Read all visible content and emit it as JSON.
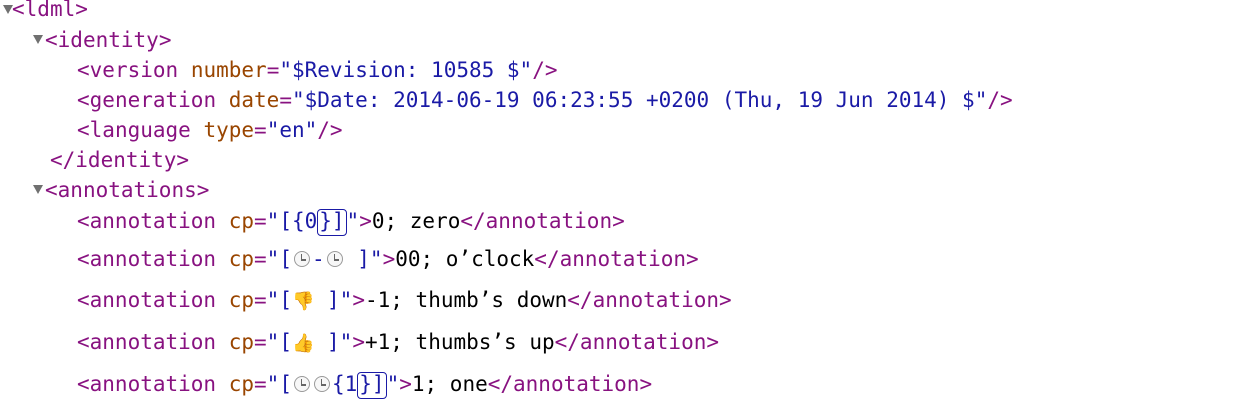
{
  "lines": {
    "ldml_open": {
      "open": "<",
      "name": "ldml",
      "close": ">"
    },
    "identity_open": {
      "open": "<",
      "name": "identity",
      "close": ">"
    },
    "version": {
      "open": "<",
      "name": "version",
      "attr": " number",
      "eq": "=",
      "value": "\"$Revision: 10585 $\"",
      "close": "/>"
    },
    "generation": {
      "open": "<",
      "name": "generation",
      "attr": " date",
      "eq": "=",
      "value": "\"$Date: 2014-06-19 06:23:55 +0200 (Thu, 19 Jun 2014) $\"",
      "close": "/>"
    },
    "language": {
      "open": "<",
      "name": "language",
      "attr": " type",
      "eq": "=",
      "value": "\"en\"",
      "close": "/>"
    },
    "identity_close": {
      "text": "</identity>"
    },
    "annotations_open": {
      "open": "<",
      "name": "annotations",
      "close": ">"
    }
  },
  "annotations": [
    {
      "tag_open": "<annotation",
      "attr": " cp",
      "eq": "=",
      "value_start": "\"[{0",
      "highlight": "}]",
      "value_end": "\"",
      "gt": ">",
      "text": "0; zero",
      "tag_close": "</annotation>"
    },
    {
      "tag_open": "<annotation",
      "attr": " cp",
      "eq": "=",
      "value_start": "\"[",
      "icons": [
        "clock-icon",
        "clock-icon"
      ],
      "separator": "-",
      "value_end": " ]\"",
      "gt": ">",
      "text": "00; o’clock",
      "tag_close": "</annotation>"
    },
    {
      "tag_open": "<annotation",
      "attr": " cp",
      "eq": "=",
      "value_start": "\"[",
      "emoji": "👎",
      "value_end": " ]\"",
      "gt": ">",
      "text": "-1; thumb’s down",
      "tag_close": "</annotation>"
    },
    {
      "tag_open": "<annotation",
      "attr": " cp",
      "eq": "=",
      "value_start": "\"[",
      "emoji": "👍",
      "value_end": " ]\"",
      "gt": ">",
      "text": "+1; thumbs’s up",
      "tag_close": "</annotation>"
    },
    {
      "tag_open": "<annotation",
      "attr": " cp",
      "eq": "=",
      "value_start": "\"[",
      "icons": [
        "clock-icon",
        "clock-icon"
      ],
      "value_mid": "{1",
      "highlight": "}]",
      "value_end": "\"",
      "gt": ">",
      "text": "1; one",
      "tag_close": "</annotation>"
    }
  ],
  "colors": {
    "tag": "#881280",
    "attribute": "#994500",
    "value": "#1a1aa6",
    "text": "#000000",
    "triangle": "#707070"
  }
}
